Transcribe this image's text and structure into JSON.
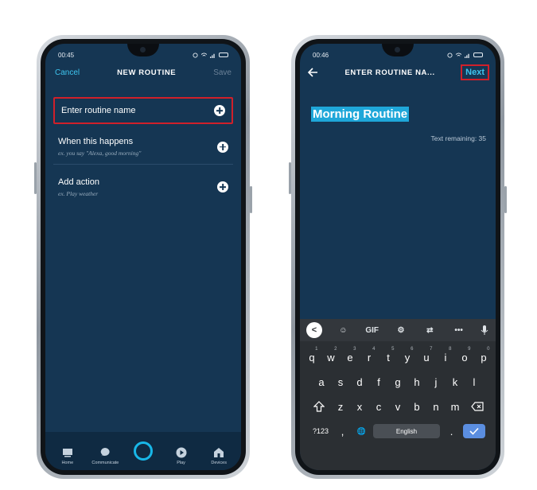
{
  "left_phone": {
    "status": {
      "time": "00:45"
    },
    "header": {
      "cancel_label": "Cancel",
      "title": "NEW ROUTINE",
      "save_label": "Save"
    },
    "rows": [
      {
        "label": "Enter routine name",
        "sub": ""
      },
      {
        "label": "When this happens",
        "sub": "ex. you say \"Alexa, good morning\""
      },
      {
        "label": "Add action",
        "sub": "ex. Play weather"
      }
    ],
    "bottom_nav": [
      {
        "label": "Home",
        "icon": "home-icon"
      },
      {
        "label": "Communicate",
        "icon": "chat-bubble-icon"
      },
      {
        "label": "",
        "icon": "alexa-ring-icon"
      },
      {
        "label": "Play",
        "icon": "play-icon"
      },
      {
        "label": "Devices",
        "icon": "devices-icon"
      }
    ]
  },
  "right_phone": {
    "status": {
      "time": "00:46"
    },
    "header": {
      "title": "ENTER ROUTINE NA...",
      "next_label": "Next",
      "back_icon": "arrow-left-icon"
    },
    "input": {
      "value": "Morning Routine",
      "remaining": "Text remaining: 35"
    },
    "keyboard": {
      "toolbar": [
        "<",
        "☺",
        "GIF",
        "⚙",
        "⇄",
        "•••",
        "mic"
      ],
      "row1": [
        {
          "k": "q",
          "n": "1"
        },
        {
          "k": "w",
          "n": "2"
        },
        {
          "k": "e",
          "n": "3"
        },
        {
          "k": "r",
          "n": "4"
        },
        {
          "k": "t",
          "n": "5"
        },
        {
          "k": "y",
          "n": "6"
        },
        {
          "k": "u",
          "n": "7"
        },
        {
          "k": "i",
          "n": "8"
        },
        {
          "k": "o",
          "n": "9"
        },
        {
          "k": "p",
          "n": "0"
        }
      ],
      "row2": [
        "a",
        "s",
        "d",
        "f",
        "g",
        "h",
        "j",
        "k",
        "l"
      ],
      "row3": [
        "z",
        "x",
        "c",
        "v",
        "b",
        "n",
        "m"
      ],
      "row4": {
        "sym": "?123",
        "comma": ",",
        "globe": "🌐",
        "space": "English",
        "period": "."
      }
    }
  },
  "colors": {
    "screen_bg": "#153653",
    "accent": "#3ec4ee",
    "highlight_border": "#d0202a",
    "selection": "#1fa7d9",
    "keyboard_bg": "#2b2f33",
    "enter_key": "#5b8ee0"
  }
}
